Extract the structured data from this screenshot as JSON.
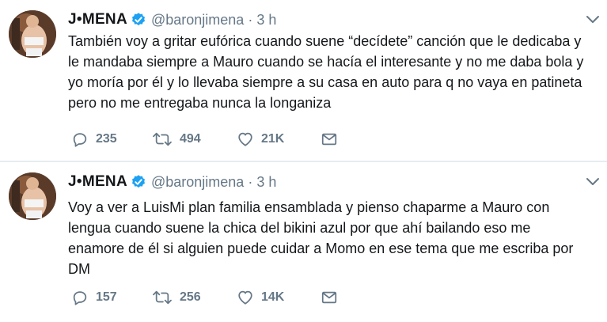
{
  "tweets": [
    {
      "user": {
        "name": "J•MENA",
        "handle": "@baronjimena",
        "verified": true
      },
      "time": "3 h",
      "text": "También voy a gritar eufórica cuando suene “decídete” canción que le dedicaba y\nle mandaba siempre a Mauro cuando se hacía el interesante y no me daba bola y\nyo moría por él y lo llevaba siempre a su casa en auto para q no vaya en patineta\npero no me entregaba nunca la longaniza",
      "replies": "235",
      "retweets": "494",
      "likes": "21K"
    },
    {
      "user": {
        "name": "J•MENA",
        "handle": "@baronjimena",
        "verified": true
      },
      "time": "3 h",
      "text": "Voy a ver a LuisMi plan familia ensamblada y pienso chaparme a Mauro con\nlengua cuando suene la chica del bikini azul por que ahí bailando eso me\nenamore de él si alguien puede cuidar a Momo en ese tema que me escriba por\nDM",
      "replies": "157",
      "retweets": "256",
      "likes": "14K"
    }
  ],
  "header_separator": "·",
  "icons": {
    "verified": "verified-badge-icon",
    "reply": "reply-icon",
    "retweet": "retweet-icon",
    "like": "heart-icon",
    "dm": "envelope-icon",
    "menu": "chevron-down-icon"
  },
  "colors": {
    "verified": "#1da1f2",
    "secondary_text": "#657786",
    "primary_text": "#14171a",
    "divider": "#e6ecf0"
  }
}
